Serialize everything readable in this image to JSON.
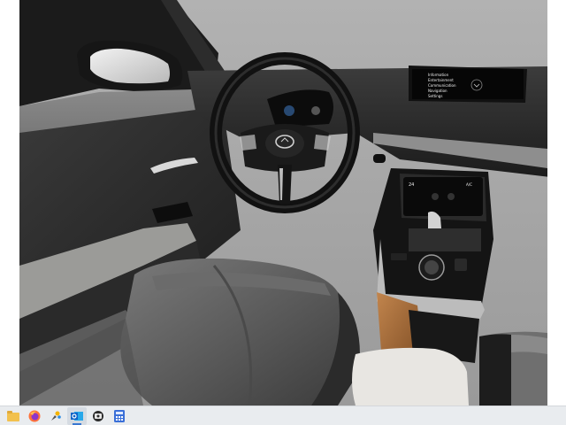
{
  "infotainment": {
    "menu_items": [
      "Information",
      "Entertainment",
      "Communication",
      "Navigation",
      "Settings"
    ],
    "selected_index": 2
  },
  "touch_panel": {
    "temperature": "24",
    "ac_label": "A/C"
  },
  "taskbar": {
    "icons": [
      "file-explorer-icon",
      "firefox-icon",
      "paint-icon",
      "outlook-icon",
      "media-player-icon",
      "calculator-icon"
    ],
    "active_index": 3
  }
}
